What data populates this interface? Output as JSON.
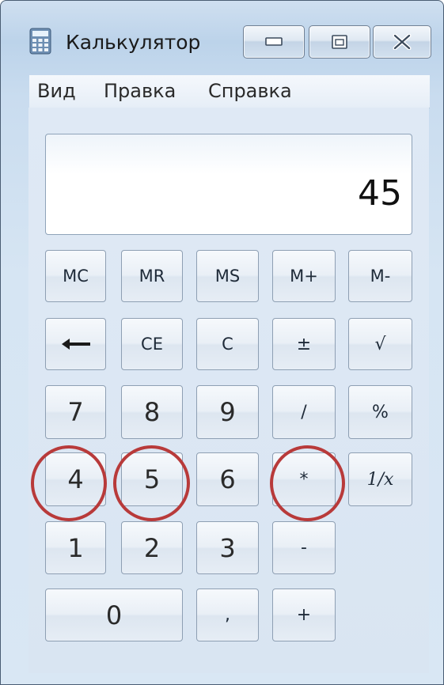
{
  "window": {
    "title": "Калькулятор",
    "app_icon": "calculator-icon"
  },
  "controls": {
    "minimize_icon": "minimize-icon",
    "maximize_icon": "maximize-icon",
    "close_icon": "close-icon"
  },
  "menu": {
    "items": [
      "Вид",
      "Правка",
      "Справка"
    ]
  },
  "display": {
    "value": "45"
  },
  "keys": {
    "mc": "MC",
    "mr": "MR",
    "ms": "MS",
    "m_plus": "M+",
    "m_minus": "M-",
    "backspace": "←",
    "ce": "CE",
    "c": "C",
    "plus_minus": "±",
    "sqrt": "√",
    "d7": "7",
    "d8": "8",
    "d9": "9",
    "divide": "/",
    "percent": "%",
    "d4": "4",
    "d5": "5",
    "d6": "6",
    "multiply": "*",
    "reciprocal": "1/x",
    "d1": "1",
    "d2": "2",
    "d3": "3",
    "minus": "-",
    "d0": "0",
    "decimal": ",",
    "plus": "+"
  },
  "annotations": {
    "highlighted_keys": [
      "4",
      "5",
      "*"
    ],
    "highlight_color": "#b83a3a"
  }
}
